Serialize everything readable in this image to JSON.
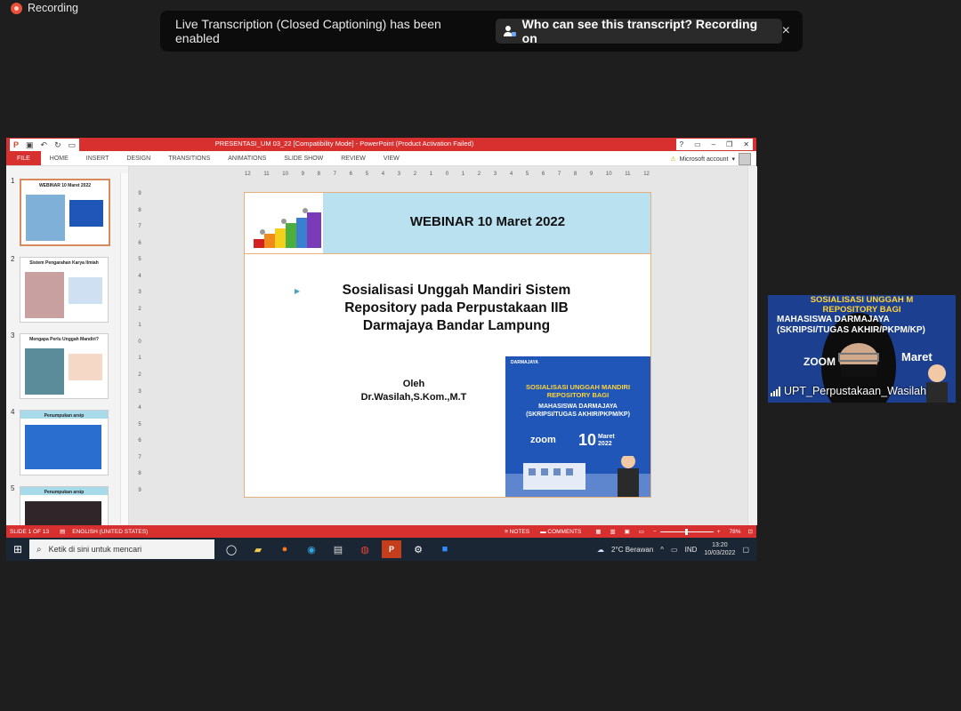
{
  "recording": {
    "label": "Recording"
  },
  "banner": {
    "message": "Live Transcription (Closed Captioning) has been enabled",
    "pill": "Who can see this transcript? Recording on",
    "close": "×"
  },
  "ppt": {
    "title": "PRESENTASI_UM 03_22 [Compatibility Mode] - PowerPoint (Product Activation Failed)",
    "tabs": [
      "FILE",
      "HOME",
      "INSERT",
      "DESIGN",
      "TRANSITIONS",
      "ANIMATIONS",
      "SLIDE SHOW",
      "REVIEW",
      "VIEW"
    ],
    "account": "Microsoft account",
    "thumbs": [
      {
        "num": "1",
        "title": "WEBINAR 10 Maret 2022"
      },
      {
        "num": "2",
        "title": "Sistem Pengarahan Karya Ilmiah"
      },
      {
        "num": "3",
        "title": "Mengapa Perlu Unggah Mandiri?"
      },
      {
        "num": "4",
        "title": "Penumpukan arsip"
      },
      {
        "num": "5",
        "title": "Penumpukan arsip"
      }
    ],
    "hruler": [
      "12",
      "11",
      "10",
      "9",
      "8",
      "7",
      "6",
      "5",
      "4",
      "3",
      "2",
      "1",
      "0",
      "1",
      "2",
      "3",
      "4",
      "5",
      "6",
      "7",
      "8",
      "9",
      "10",
      "11",
      "12"
    ],
    "vruler": [
      "9",
      "8",
      "7",
      "6",
      "5",
      "4",
      "3",
      "2",
      "1",
      "0",
      "1",
      "2",
      "3",
      "4",
      "5",
      "6",
      "7",
      "8",
      "9"
    ],
    "slide": {
      "header": "WEBINAR 10 Maret 2022",
      "line1": "Sosialisasi Unggah Mandiri Sistem",
      "line2": "Repository pada Perpustakaan IIB",
      "line3": "Darmajaya Bandar Lampung",
      "by_label": "Oleh",
      "author": "Dr.Wasilah,S.Kom.,M.T"
    },
    "poster": {
      "brand": "DARMAJAYA",
      "title1": "SOSIALISASI UNGGAH MANDIRI",
      "title2": "REPOSITORY BAGI",
      "sub1": "MAHASISWA DARMAJAYA",
      "sub2": "(SKRIPSI/TUGAS AKHIR/PKPM/KP)",
      "zoom": "zoom",
      "date_day": "10",
      "date_month": "Maret",
      "date_year": "2022"
    },
    "status": {
      "slide": "SLIDE 1 OF 13",
      "lang": "ENGLISH (UNITED STATES)",
      "notes": "NOTES",
      "comments": "COMMENTS",
      "zoom": "78%"
    }
  },
  "taskbar": {
    "search_placeholder": "Ketik di sini untuk mencari",
    "weather": "2°C Berawan",
    "lang": "IND",
    "time": "13:20",
    "date": "10/03/2022"
  },
  "video": {
    "name": "UPT_Perpustakaan_Wasilah",
    "poster_line1": "SOSIALISASI UNGGAH M",
    "poster_line2": "REPOSITORY BAGI",
    "poster_line3": "MAHASISWA DARMAJAYA",
    "poster_line4": "(SKRIPSI/TUGAS AKHIR/PKPM/KP)",
    "poster_zoom": "ZOOM",
    "poster_month": "Maret"
  },
  "colors": {
    "ppt_red": "#d82f2f",
    "banner_bg": "#0c0c0c",
    "slide_header": "#b9e1ef",
    "poster_blue": "#1f56b7"
  }
}
